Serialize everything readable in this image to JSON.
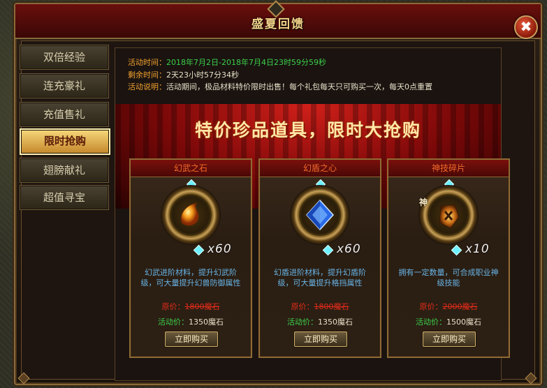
{
  "window": {
    "title": "盛夏回馈",
    "close_label": "✖"
  },
  "tabs": [
    {
      "label": "双倍经验",
      "active": false
    },
    {
      "label": "连充豪礼",
      "active": false
    },
    {
      "label": "充值售礼",
      "active": false
    },
    {
      "label": "限时抢购",
      "active": true
    },
    {
      "label": "翅膀献礼",
      "active": false
    },
    {
      "label": "超值寻宝",
      "active": false
    }
  ],
  "info": {
    "time_key": "活动时间：",
    "time_value": "2018年7月2日-2018年7月4日23时59分59秒",
    "remain_key": "剩余时间：",
    "remain_value": "2天23小时57分34秒",
    "desc_key": "活动说明：",
    "desc_value": "活动期间，极品材料特价限时出售！每个礼包每天只可购买一次，每天0点重置"
  },
  "headline": "特价珍品道具，限时大抢购",
  "items": [
    {
      "name": "幻武之石",
      "quantity": "x60",
      "icon": "phantom-stone-icon",
      "desc": "幻武进阶材料，提升幻武阶级，可大量提升幻兽防御属性",
      "orig_label": "原价：",
      "orig_price": "1800魔石",
      "act_label": "活动价：",
      "act_price": "1350魔石",
      "buy_label": "立即购买"
    },
    {
      "name": "幻盾之心",
      "quantity": "x60",
      "icon": "shield-crystal-icon",
      "desc": "幻盾进阶材料，提升幻盾阶级，可大量提升格挡属性",
      "orig_label": "原价：",
      "orig_price": "1800魔石",
      "act_label": "活动价：",
      "act_price": "1350魔石",
      "buy_label": "立即购买"
    },
    {
      "name": "神技碎片",
      "quantity": "x10",
      "icon": "divine-skill-fragment-icon",
      "badge": "神",
      "desc": "拥有一定数量，可合成职业神级技能",
      "orig_label": "原价：",
      "orig_price": "2000魔石",
      "act_label": "活动价：",
      "act_price": "1500魔石",
      "buy_label": "立即购买"
    }
  ],
  "colors": {
    "accent_gold": "#f3d38a",
    "price_red": "#e52b1a",
    "price_green": "#3bd04a",
    "desc_blue": "#68b4e6"
  }
}
